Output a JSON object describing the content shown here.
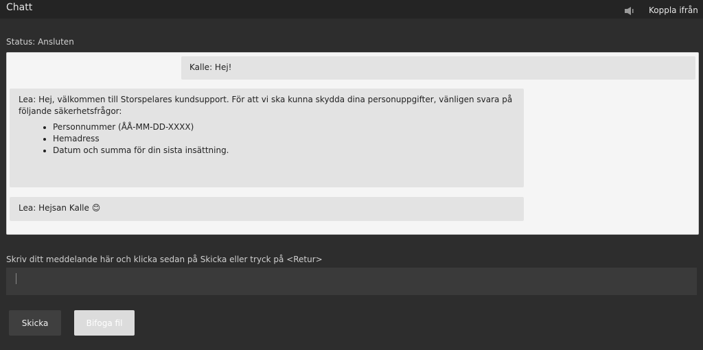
{
  "header": {
    "title": "Chatt",
    "sound_icon": "speaker-icon",
    "disconnect_label": "Koppla ifrån"
  },
  "status": {
    "text": "Status: Ansluten"
  },
  "messages": [
    {
      "sender": "Kalle",
      "text": "Kalle: Hej!"
    },
    {
      "sender": "Lea",
      "text": "Lea: Hej, välkommen till Storspelares kundsupport. För att vi ska kunna skydda dina personuppgifter, vänligen svara på följande säkerhetsfrågor:",
      "list": [
        "Personnummer (ÅÅ-MM-DD-XXXX)",
        "Hemadress",
        "Datum och summa för din sista insättning."
      ]
    },
    {
      "sender": "Lea",
      "text": "Lea: Hejsan Kalle 😊"
    }
  ],
  "composer": {
    "hint": "Skriv ditt meddelande här och klicka sedan på Skicka eller tryck på <Retur>",
    "value": "",
    "send_label": "Skicka",
    "attach_label": "Bifoga fil"
  },
  "colors": {
    "background": "#2d2d2d",
    "header": "#242424",
    "chat_panel": "#f5f5f5",
    "bubble": "#e3e3e3",
    "input": "#3a3a3a",
    "send_button": "#3f3f3f",
    "attach_button_disabled": "#dcdcdc"
  }
}
